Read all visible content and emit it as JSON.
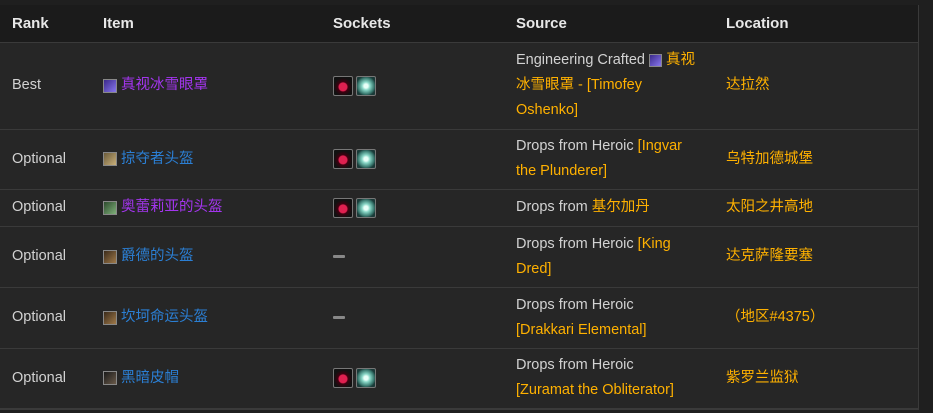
{
  "headers": {
    "rank": "Rank",
    "item": "Item",
    "sockets": "Sockets",
    "source": "Source",
    "location": "Location"
  },
  "rows": [
    {
      "rank": "Best",
      "item": "真视冰雪眼罩",
      "item_icon": "goggles-icon",
      "sockets": [
        "meta-socket",
        "prismatic-socket"
      ],
      "source_line1": "Engineering Crafted ",
      "source_link_icon": "goggles-icon",
      "source_line1_link": "真视",
      "source_line2": "冰雪眼罩 - [Timofey",
      "source_line3": "Oshenko]",
      "location": "达拉然"
    },
    {
      "rank": "Optional",
      "item": "掠夺者头盔",
      "item_icon": "helm-icon",
      "sockets": [
        "meta-socket",
        "prismatic-socket"
      ],
      "source_prefix": "Drops from Heroic ",
      "source_link1": "[Ingvar",
      "source_link2": "the Plunderer]",
      "location": "乌特加德城堡"
    },
    {
      "rank": "Optional",
      "item": "奥蕾莉亚的头盔",
      "item_icon": "helm-icon",
      "sockets": [
        "meta-socket",
        "prismatic-socket"
      ],
      "source_prefix": "Drops from ",
      "source_link1": "基尔加丹",
      "location": "太阳之井高地"
    },
    {
      "rank": "Optional",
      "item": "爵德的头盔",
      "item_icon": "helm-icon",
      "sockets_empty": "—",
      "source_prefix": "Drops from Heroic ",
      "source_link1": "[King",
      "source_link2": "Dred]",
      "location": "达克萨隆要塞"
    },
    {
      "rank": "Optional",
      "item": "坎坷命运头盔",
      "item_icon": "helm-icon",
      "sockets_empty": "—",
      "source_prefix": "Drops from Heroic",
      "source_link2": "[Drakkari Elemental]",
      "location": "（地区#4375）"
    },
    {
      "rank": "Optional",
      "item": "黑暗皮帽",
      "item_icon": "cap-icon",
      "sockets": [
        "meta-socket",
        "prismatic-socket"
      ],
      "source_prefix": "Drops from Heroic",
      "source_link2": "[Zuramat the Obliterator]",
      "location": "紫罗兰监狱"
    }
  ],
  "colors": {
    "epic": "#a335ee",
    "rare": "#2b7fd4",
    "link": "#ffb100",
    "background": "#262626"
  }
}
